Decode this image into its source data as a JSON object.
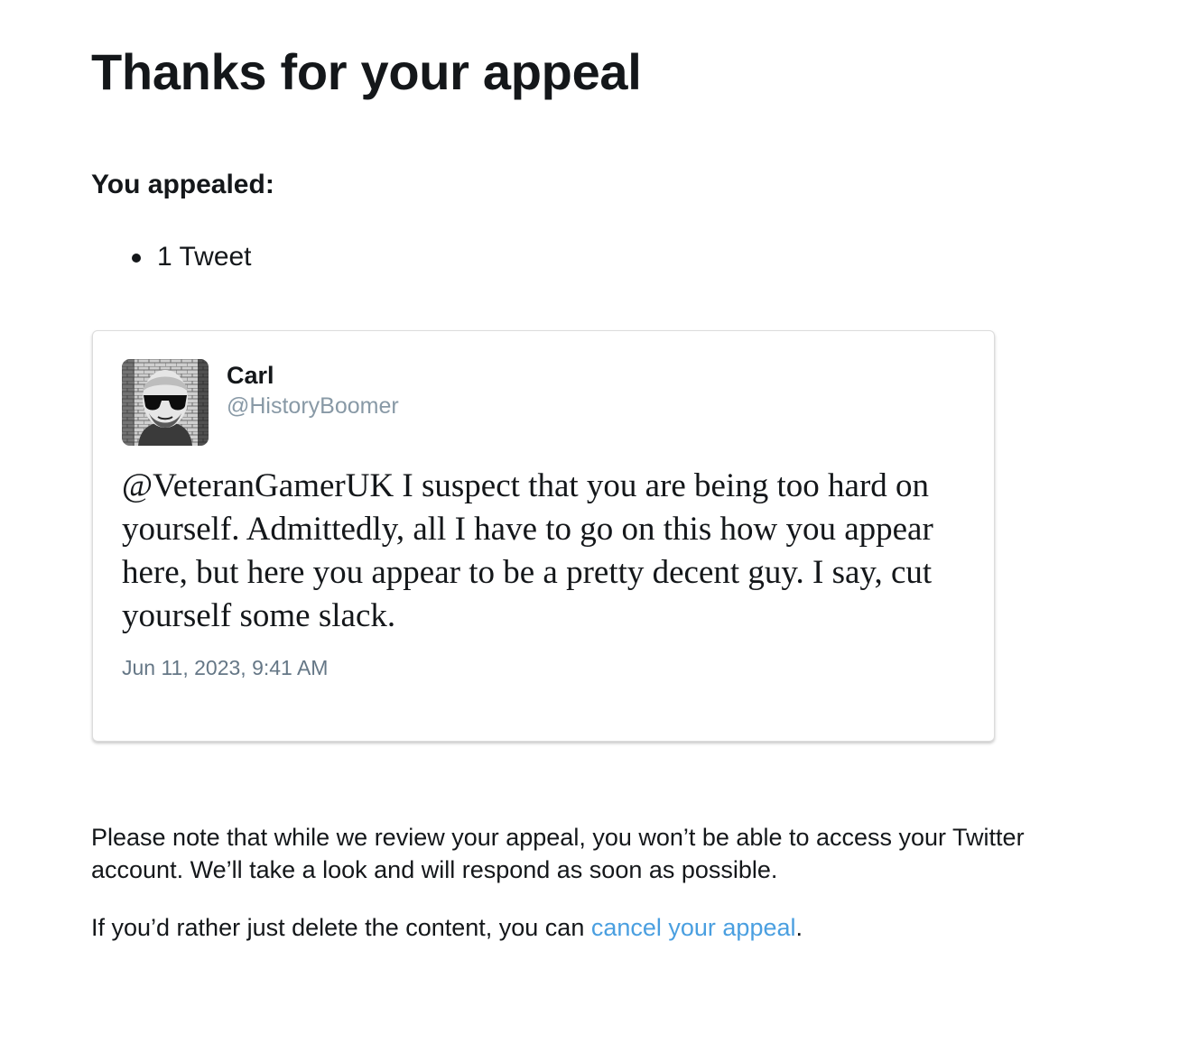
{
  "page": {
    "title": "Thanks for your appeal",
    "appealed_label": "You appealed:",
    "appealed_items": [
      "1 Tweet"
    ]
  },
  "tweet": {
    "author_name": "Carl",
    "author_handle": "@HistoryBoomer",
    "avatar": "avatar-photo",
    "text": "@VeteranGamerUK I suspect that you are being too hard on yourself. Admittedly, all I have to go on this how you appear here, but here you appear to be a pretty decent guy. I say, cut yourself some slack.",
    "timestamp": "Jun 11, 2023, 9:41 AM"
  },
  "notice": {
    "review_note": "Please note that while we review your appeal, you won’t be able to access your Twitter account. We’ll take a look and will respond as soon as possible.",
    "cancel_prefix": "If you’d rather just delete the content, you can ",
    "cancel_link": "cancel your appeal",
    "cancel_suffix": "."
  },
  "colors": {
    "text": "#14171a",
    "handle": "#8899a6",
    "timestamp": "#657786",
    "link": "#4a9fe0",
    "card_border": "#dcdcdc"
  }
}
